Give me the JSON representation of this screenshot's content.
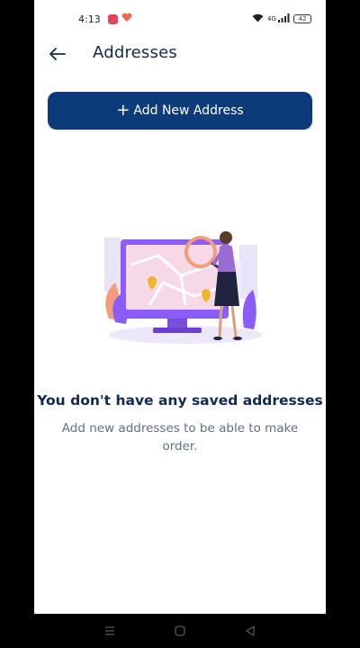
{
  "status_bar": {
    "time": "4:13",
    "battery": "42",
    "icons": [
      "notification-app-icon",
      "notification-health-icon",
      "wifi-icon",
      "volte-icon",
      "signal-icon",
      "battery-icon"
    ]
  },
  "app_bar": {
    "title": "Addresses",
    "back_icon": "arrow-left-icon"
  },
  "actions": {
    "add_address_icon": "+",
    "add_address_label": "Add New Address"
  },
  "empty_state": {
    "illustration": "woman-with-magnifier-over-monitor-map-illustration",
    "title": "You don't have any saved addresses",
    "subtitle": "Add new addresses to be able to make order."
  },
  "nav_bar": {
    "icons": [
      "menu-icon",
      "home-icon",
      "back-icon"
    ]
  },
  "colors": {
    "primary": "#0d3b7a",
    "title_text": "#0f2a52",
    "subtitle_text": "#5f7286",
    "illustration_purple": "#8b5cf6"
  }
}
